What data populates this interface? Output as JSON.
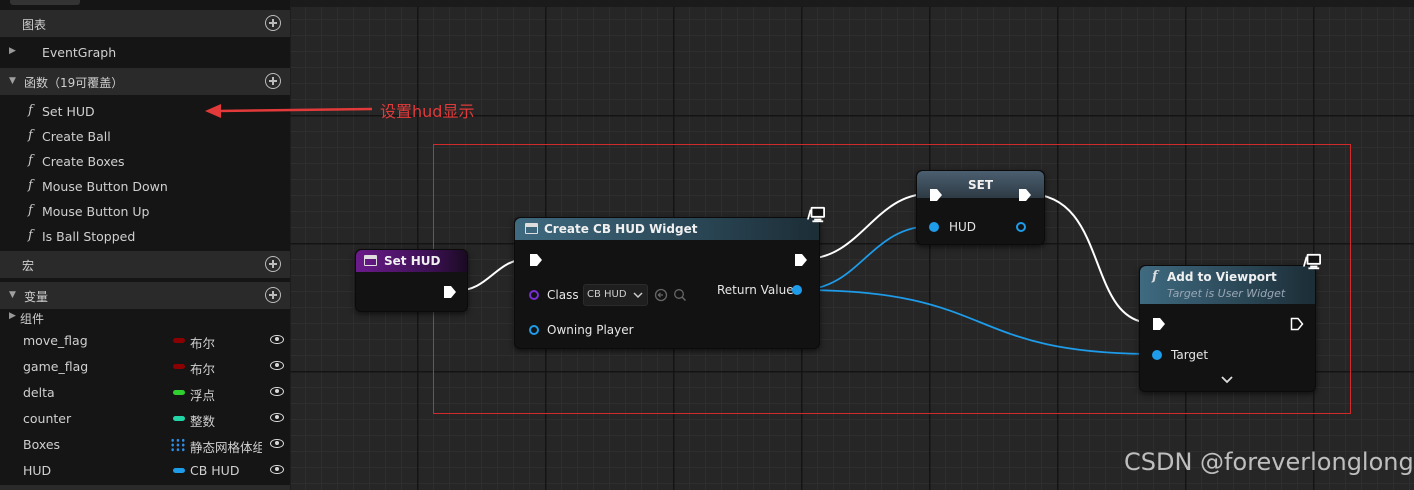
{
  "panel": {
    "graph_section": "图表",
    "event_graph": "EventGraph",
    "functions_section": "函数（19可覆盖）",
    "functions": [
      "Set HUD",
      "Create Ball",
      "Create Boxes",
      "Mouse Button Down",
      "Mouse Button Up",
      "Is Ball Stopped"
    ],
    "macros_section": "宏",
    "variables_section": "变量",
    "components": "组件",
    "variables": [
      {
        "name": "move_flag",
        "type": "布尔",
        "color": "#8b0000"
      },
      {
        "name": "game_flag",
        "type": "布尔",
        "color": "#8b0000"
      },
      {
        "name": "delta",
        "type": "浮点",
        "color": "#2fcf2f"
      },
      {
        "name": "counter",
        "type": "整数",
        "color": "#22d4a6"
      },
      {
        "name": "Boxes",
        "type": "静态网格体组",
        "color": "#2f8fe6"
      },
      {
        "name": "HUD",
        "type": "CB HUD",
        "color": "#1e9be9"
      }
    ],
    "function_icon": "f",
    "expand_icon": "▶",
    "collapse_icon": "▼"
  },
  "annotation": "设置hud显示",
  "nodes": {
    "set_hud": {
      "title": "Set HUD"
    },
    "create_widget": {
      "title": "Create CB HUD Widget",
      "class_label": "Class",
      "class_value": "CB HUD",
      "owning_player": "Owning Player",
      "return_value": "Return Value"
    },
    "set": {
      "title": "SET",
      "var": "HUD"
    },
    "add_to_viewport": {
      "title": "Add to Viewport",
      "subtitle": "Target is User Widget",
      "target": "Target",
      "function_icon": "f"
    }
  },
  "watermark": "CSDN @foreverlonglong",
  "colors": {
    "exec": "#ffffff",
    "object_pin": "#1e9be9",
    "class_pin": "#7a2ed6",
    "highlight": "#d12a2a"
  }
}
